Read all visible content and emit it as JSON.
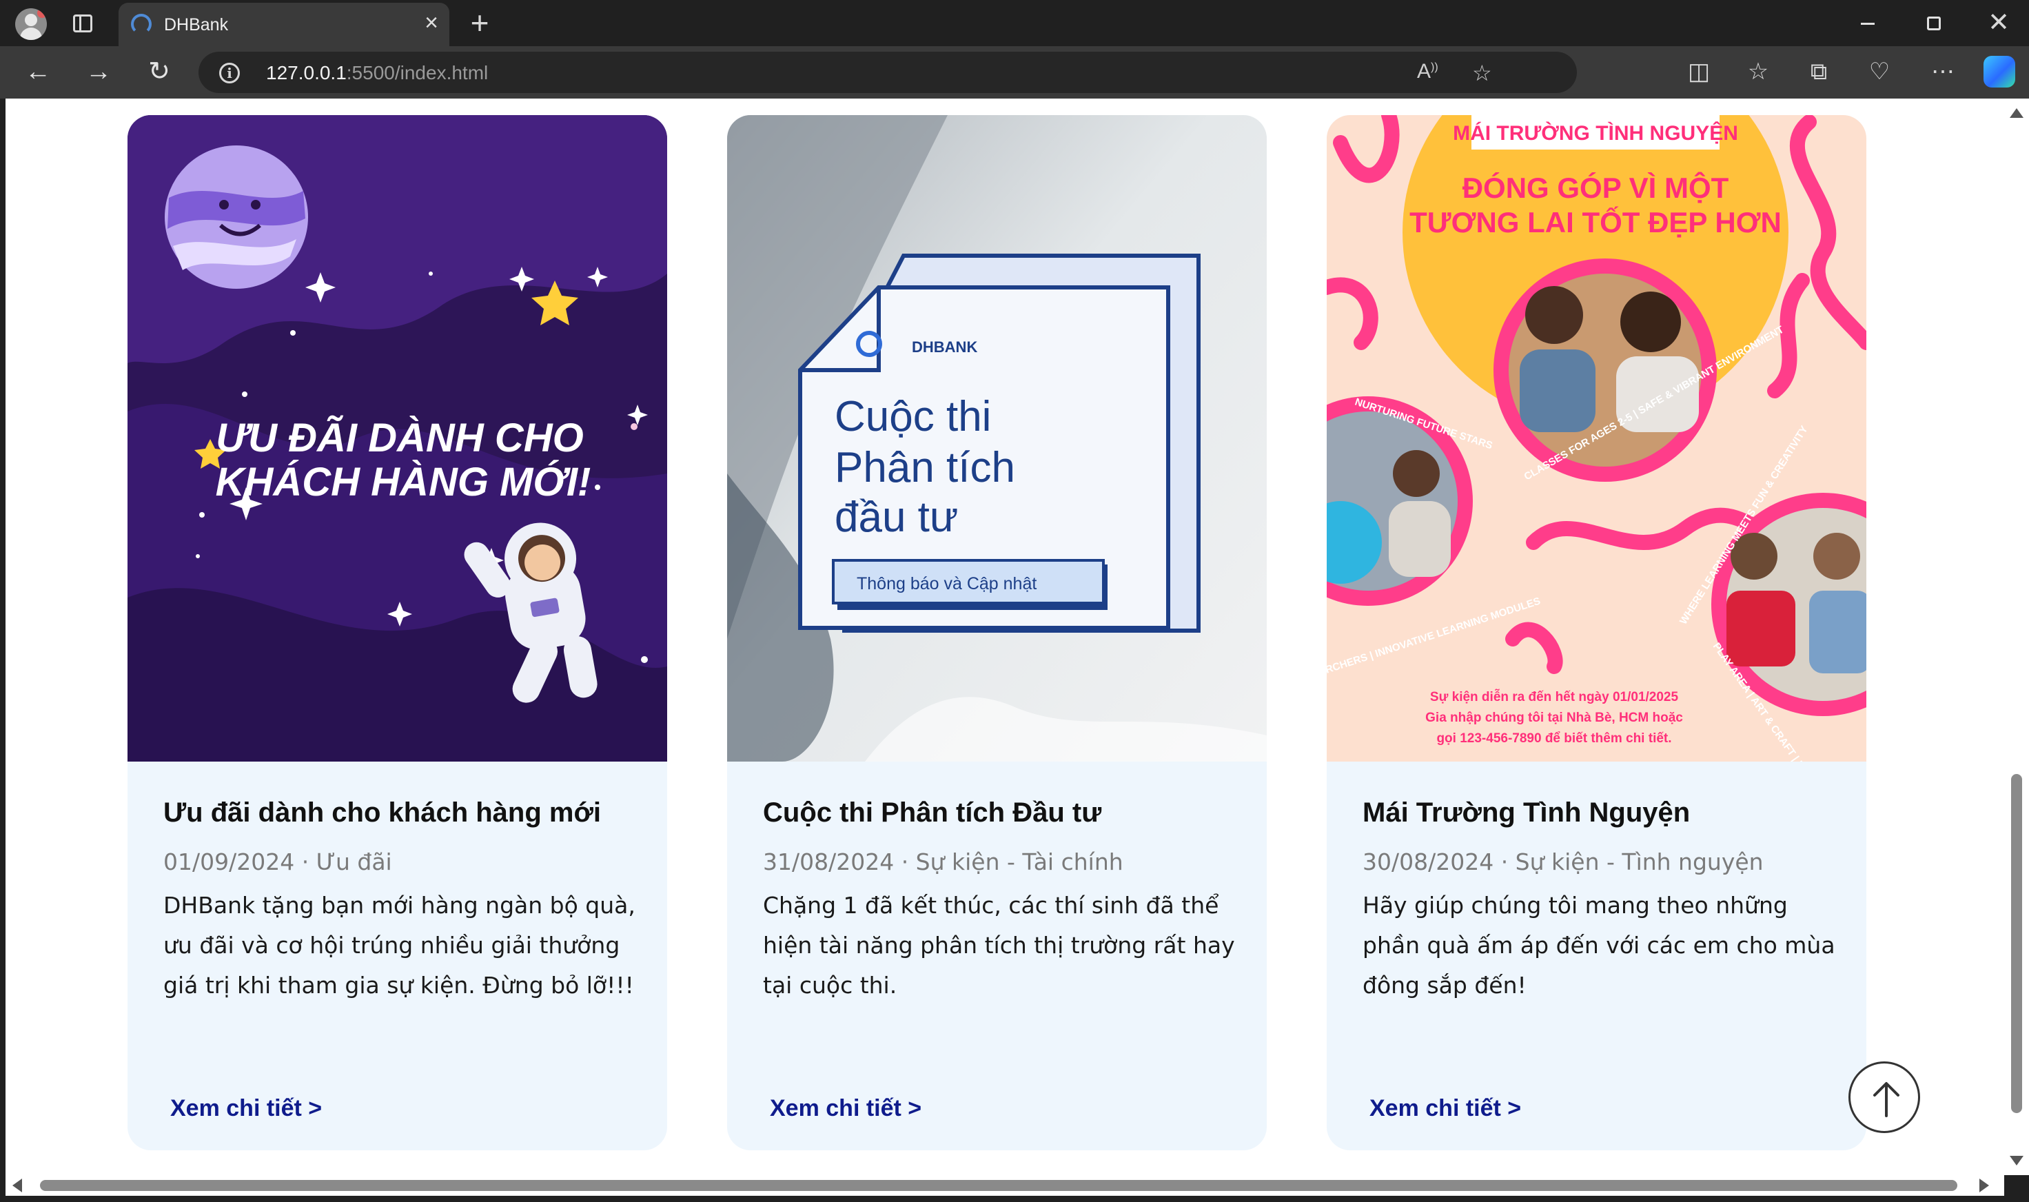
{
  "browser": {
    "tab_title": "DHBank",
    "tab_close": "×",
    "new_tab": "+",
    "url_host": "127.0.0.1",
    "url_rest": ":5500/index.html",
    "reader_icon": "A",
    "reader_icon_sup": "))"
  },
  "cards": [
    {
      "title": "Ưu đãi dành cho khách hàng mới",
      "meta": "01/09/2024 · Ưu đãi",
      "description": "DHBank tặng bạn mới hàng ngàn bộ quà, ưu đãi và cơ hội trúng nhiều giải thưởng giá trị khi tham gia sự kiện. Đừng bỏ lỡ!!!",
      "link": "Xem chi tiết >",
      "poster": {
        "line1": "ƯU ĐÃI DÀNH CHO",
        "line2": "KHÁCH HÀNG MỚI!"
      }
    },
    {
      "title": "Cuộc thi Phân tích Đầu tư",
      "meta": "31/08/2024 · Sự kiện - Tài chính",
      "description": "Chặng 1 đã kết thúc, các thí sinh đã thể hiện tài năng phân tích thị trường rất hay tại cuộc thi.",
      "link": "Xem chi tiết >",
      "poster": {
        "brand": "DHBANK",
        "line1": "Cuộc thi",
        "line2": "Phân tích",
        "line3": "đầu tư",
        "tag": "Thông báo và Cập nhật"
      }
    },
    {
      "title": "Mái Trường Tình Nguyện",
      "meta": "30/08/2024 · Sự kiện - Tình nguyện",
      "description": "Hãy giúp chúng tôi mang theo những phần quà ấm áp đến với các em cho mùa đông sắp đến!",
      "link": "Xem chi tiết >",
      "poster": {
        "banner": "MÁI TRƯỜNG TÌNH NGUYỆN",
        "head1": "ĐÓNG GÓP VÌ MỘT",
        "head2": "TƯƠNG LAI TỐT ĐẸP HƠN",
        "ring1": "CLASSES FOR AGES 2-5 | SAFE & VIBRANT ENVIRONMENT",
        "ring2": "NURTURING FUTURE STARS",
        "ring3": "RCHERS | INNOVATIVE LEARNING MODULES",
        "ring4": "WHERE LEARNING MEETS FUN & CREATIVITY",
        "ring5": "PLAY AREA | ART & CRAFT | MUSIC & DANC",
        "foot1": "Sự kiện diễn ra đến hết ngày 01/01/2025",
        "foot2": "Gia nhập chúng tôi tại Nhà Bè, HCM hoặc",
        "foot3": "gọi 123-456-7890 để biết thêm chi tiết."
      }
    }
  ],
  "colors": {
    "card_bg": "#eef6fd",
    "link": "#0f1c8c",
    "meta": "#7a7a7a",
    "poster1_bg": "#2d1557",
    "poster3_bg": "#fde0cf",
    "poster3_accent": "#ff3d8a",
    "poster3_sun": "#ffc13b"
  }
}
